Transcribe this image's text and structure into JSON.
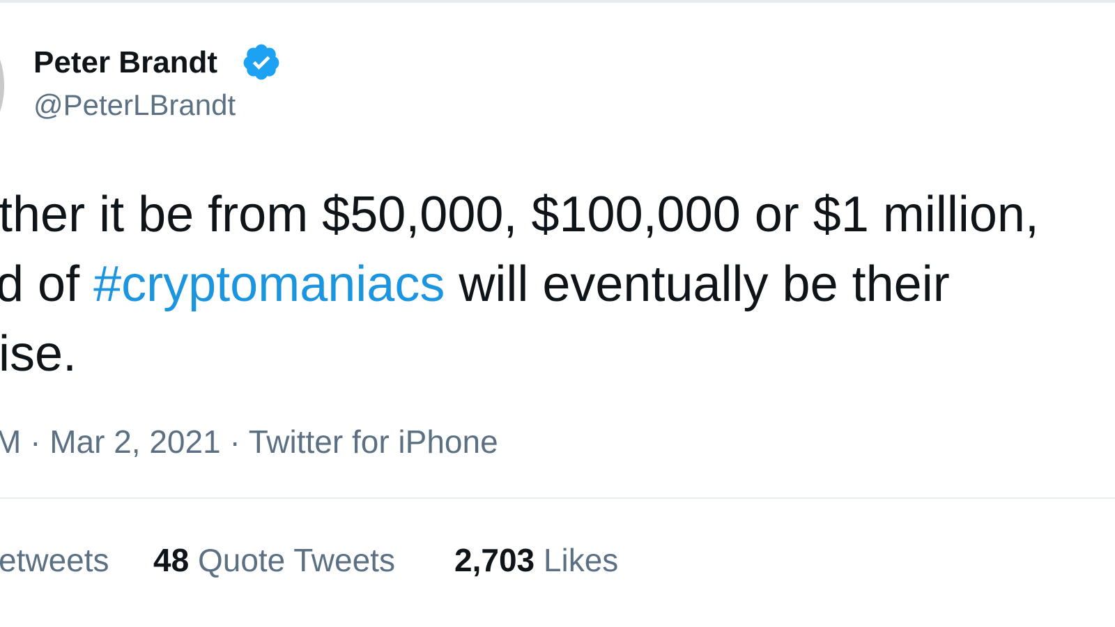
{
  "tweet": {
    "author": {
      "display_name": "Peter Brandt",
      "handle": "@PeterLBrandt",
      "verified": true
    },
    "text": {
      "line1": "ther it be from $50,000, $100,000 or $1 million,",
      "line2_before": "d of ",
      "hashtag": "#cryptomaniacs",
      "line2_after": " will eventually be their",
      "line3": "ise."
    },
    "meta": "M · Mar 2, 2021 · Twitter for iPhone",
    "stats": {
      "retweets_label": "etweets",
      "quotes_count": "48",
      "quotes_label": "Quote Tweets",
      "likes_count": "2,703",
      "likes_label": "Likes"
    }
  },
  "colors": {
    "text": "#0f1419",
    "secondary": "#5b7083",
    "link": "#1b95e0",
    "verified": "#1da1f2",
    "divider": "#e6ecf0"
  },
  "icons": {
    "verified": "verified-badge-icon"
  }
}
